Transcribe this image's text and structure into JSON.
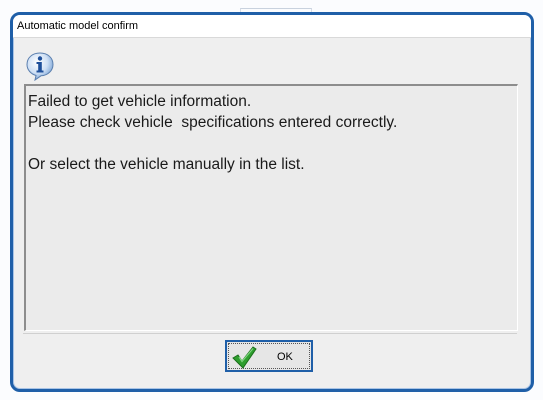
{
  "window": {
    "title": "Automatic model confirm"
  },
  "dialog": {
    "icon": "info-icon",
    "message_lines": [
      "Failed to get vehicle information.",
      "Please check vehicle  specifications entered correctly.",
      "",
      "Or select the vehicle manually in the list."
    ]
  },
  "buttons": {
    "ok_label": "OK",
    "ok_icon": "checkmark-icon"
  },
  "colors": {
    "frame": "#1f5fa8",
    "dialog_bg": "#efefef",
    "check": "#2e9e2e"
  }
}
